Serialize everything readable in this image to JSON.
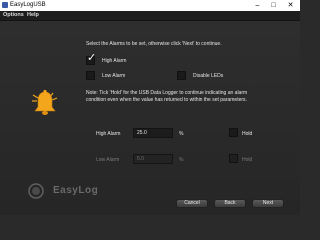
{
  "window": {
    "title": "EasyLogUSB",
    "minimize_glyph": "–",
    "maximize_glyph": "□",
    "close_glyph": "✕"
  },
  "menu": {
    "options": "Options",
    "help": "Help"
  },
  "instructions": {
    "select_alarms": "Select the Alarms to be set, otherwise click 'Next' to continue.",
    "note_line1": "Note: Tick 'Hold' for the USB Data Logger to continue indicating an alarm",
    "note_line2": "condition even when the value has returned to within the set parameters."
  },
  "checkboxes": {
    "high_alarm": {
      "label": "High Alarm",
      "checked": true
    },
    "low_alarm": {
      "label": "Low Alarm",
      "checked": false
    },
    "disable_leds": {
      "label": "Disable LEDs",
      "checked": false
    }
  },
  "thresholds": {
    "high": {
      "label": "High Alarm",
      "value": "25.0",
      "unit": "%",
      "hold_label": "Hold",
      "hold_checked": false,
      "enabled": true
    },
    "low": {
      "label": "Low Alarm",
      "value": "5.0",
      "unit": "%",
      "hold_label": "Hold",
      "hold_checked": false,
      "enabled": false
    }
  },
  "buttons": {
    "cancel": "Cancel",
    "back": "Back",
    "next": "Next"
  },
  "brand": {
    "logo_text": "EasyLog"
  },
  "colors": {
    "background": "#2b2b2b",
    "text": "#e6e6e6",
    "bell": "#f3a51c"
  },
  "icons": {
    "bell": "bell-icon",
    "check": "checkmark-icon",
    "logo": "easylog-logo"
  }
}
